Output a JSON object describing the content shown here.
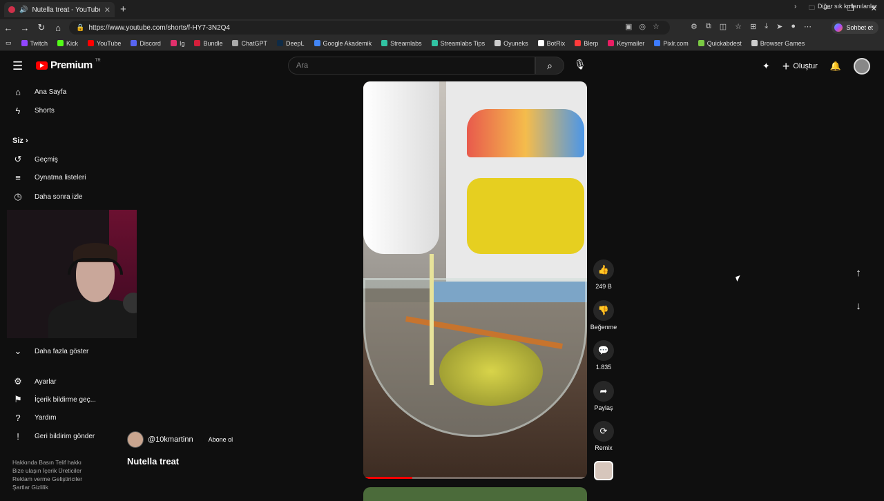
{
  "browser": {
    "tab_title": "Nutella treat - YouTube",
    "url": "https://www.youtube.com/shorts/f-HY7-3N2Q4",
    "copilot_label": "Sohbet et",
    "bookmarks": [
      "Twitch",
      "Kick",
      "YouTube",
      "Discord",
      "Ig",
      "Bundle",
      "ChatGPT",
      "DeepL",
      "Google Akademik",
      "Streamlabs",
      "Streamlabs Tips",
      "Oyuneks",
      "BotRix",
      "Blerp",
      "Keymailer",
      "Pixlr.com",
      "Quickabdest",
      "Browser Games"
    ],
    "bookmark_colors": [
      "#9146ff",
      "#53fc18",
      "#ff0000",
      "#5865f2",
      "#e1306c",
      "#d41f3a",
      "#aaaaaa",
      "#0f2b46",
      "#4285f4",
      "#31c3a2",
      "#31c3a2",
      "#cccccc",
      "#ffffff",
      "#ff3b3b",
      "#e91e63",
      "#3d7bff",
      "#7ac943",
      "#cccccc"
    ],
    "other_bookmarks": "Diğer sık kullanılanlar"
  },
  "header": {
    "logo_text": "Premium",
    "logo_sup": "TR",
    "search_placeholder": "Ara",
    "create_label": "Oluştur"
  },
  "sidebar": {
    "home": "Ana Sayfa",
    "shorts": "Shorts",
    "you": "Siz",
    "history": "Geçmiş",
    "playlists": "Oynatma listeleri",
    "watch_later": "Daha sonra izle",
    "show_more": "Daha fazla göster",
    "settings": "Ayarlar",
    "report": "İçerik bildirme geç...",
    "help": "Yardım",
    "feedback": "Geri bildirim gönder",
    "footer_line1": "Hakkında  Basın  Telif hakkı",
    "footer_line2": "Bize ulaşın  İçerik Üreticiler",
    "footer_line3": "Reklam verme  Geliştiriciler",
    "footer_line4": "Şartlar  Gizlilik"
  },
  "short": {
    "channel": "@10kmartinn",
    "subscribe": "Abone ol",
    "title": "Nutella treat",
    "likes": "249 B",
    "dislike_label": "Beğenme",
    "comments": "1.835",
    "share_label": "Paylaş",
    "remix_label": "Remix",
    "progress": 0.22
  }
}
